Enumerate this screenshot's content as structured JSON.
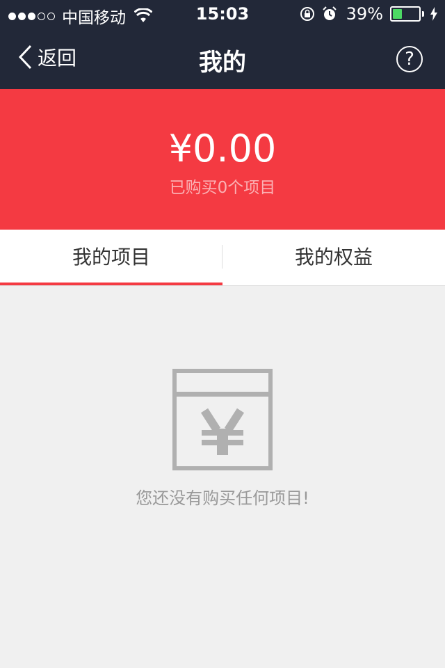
{
  "status_bar": {
    "carrier": "中国移动",
    "time": "15:03",
    "battery_percent": "39%",
    "battery_level": 0.39,
    "signal_bars_filled": 3,
    "signal_bars_total": 5
  },
  "nav": {
    "back_label": "返回",
    "title": "我的",
    "help_label": "?"
  },
  "balance": {
    "amount": "¥0.00",
    "subtitle": "已购买0个项目"
  },
  "tabs": [
    {
      "label": "我的项目",
      "selected": true
    },
    {
      "label": "我的权益",
      "selected": false
    }
  ],
  "empty_state": {
    "icon": "yuan-wallet-icon",
    "message": "您还没有购买任何项目!"
  },
  "colors": {
    "header_bg": "#222838",
    "accent_red": "#f43a42",
    "page_bg": "#f0f0f0",
    "battery_green": "#4cd964"
  }
}
